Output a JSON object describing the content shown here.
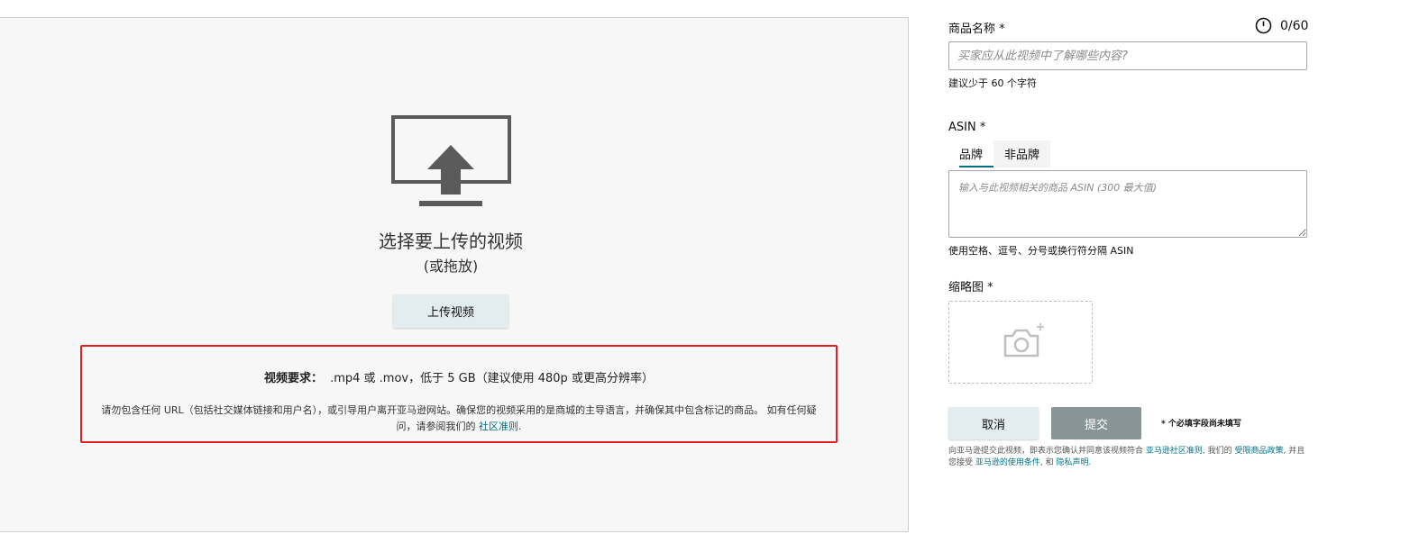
{
  "upload": {
    "title": "选择要上传的视频",
    "subtitle": "(或拖放)",
    "button_label": "上传视频"
  },
  "requirements": {
    "heading": "视频要求：",
    "formats": ".mp4 或 .mov，低于 5 GB（建议使用 480p 或更高分辨率）",
    "note": "请勿包含任何 URL（包括社交媒体链接和用户名），或引导用户离开亚马逊网站。确保您的视频采用的是商城的主导语言，并确保其中包含标记的商品。 如有任何疑问，请参阅我们的 ",
    "link_label": "社区准则",
    "note_end": "."
  },
  "form": {
    "product_name_label": "商品名称 *",
    "counter": "0/60",
    "product_name_placeholder": "买家应从此视频中了解哪些内容?",
    "product_name_hint": "建议少于 60 个字符",
    "asin_label": "ASIN *",
    "tabs": [
      {
        "label": "品牌",
        "active": true
      },
      {
        "label": "非品牌",
        "active": false
      }
    ],
    "asin_placeholder": "输入与此视频相关的商品 ASIN (300 最大值)",
    "asin_hint": "使用空格、逗号、分号或换行符分隔 ASIN",
    "thumbnail_label": "缩略图 *",
    "cancel_label": "取消",
    "submit_label": "提交",
    "required_note": "* 个必填字段尚未填写",
    "legal": {
      "part1": "向亚马逊提交此视频，即表示您确认并同意该视频符合 ",
      "link1": "亚马逊社区准则",
      "part2": ", 我们的 ",
      "link2": "受限商品政策",
      "part3": ", 并且您接受 ",
      "link3": "亚马逊的使用条件",
      "part4": ", 和 ",
      "link4": "隐私声明",
      "part5": "."
    }
  },
  "colors": {
    "accent": "#007185",
    "highlight_border": "#e02020",
    "secondary_button": "#e3ecee",
    "disabled_button": "#879596",
    "icon": "#5b5b5b"
  },
  "icons": {
    "upload": "monitor-upload-icon",
    "counter": "timer-icon",
    "thumbnail": "camera-plus-icon"
  }
}
